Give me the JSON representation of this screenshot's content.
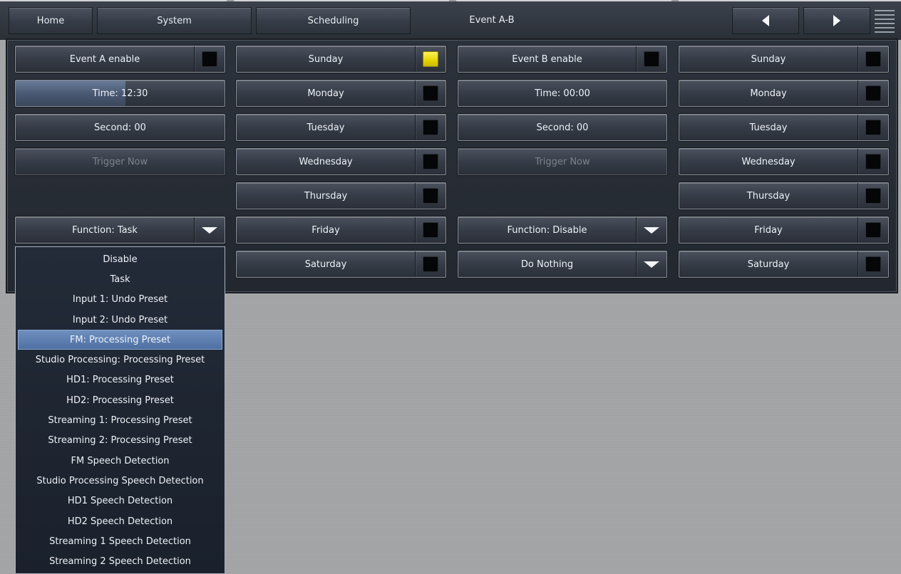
{
  "nav": {
    "home": "Home",
    "system": "System",
    "scheduling": "Scheduling",
    "title": "Event A-B",
    "prev_icon": "triangle-left",
    "next_icon": "triangle-right",
    "menu_icon": "hamburger-lines"
  },
  "event_a": {
    "enable_label": "Event A enable",
    "enabled": false,
    "time_label": "Time: 12:30",
    "time_fill_fraction": 0.52,
    "second_label": "Second: 00",
    "trigger_label": "Trigger Now",
    "function_label": "Function: Task",
    "days": [
      {
        "label": "Sunday",
        "checked": true
      },
      {
        "label": "Monday",
        "checked": false
      },
      {
        "label": "Tuesday",
        "checked": false
      },
      {
        "label": "Wednesday",
        "checked": false
      },
      {
        "label": "Thursday",
        "checked": false
      },
      {
        "label": "Friday",
        "checked": false
      },
      {
        "label": "Saturday",
        "checked": false
      }
    ]
  },
  "event_b": {
    "enable_label": "Event B enable",
    "enabled": false,
    "time_label": "Time: 00:00",
    "second_label": "Second: 00",
    "trigger_label": "Trigger Now",
    "function_label": "Function: Disable",
    "action_label": "Do Nothing",
    "days": [
      {
        "label": "Sunday",
        "checked": false
      },
      {
        "label": "Monday",
        "checked": false
      },
      {
        "label": "Tuesday",
        "checked": false
      },
      {
        "label": "Wednesday",
        "checked": false
      },
      {
        "label": "Thursday",
        "checked": false
      },
      {
        "label": "Friday",
        "checked": false
      },
      {
        "label": "Saturday",
        "checked": false
      }
    ]
  },
  "function_dropdown": {
    "selected_index": 4,
    "options": [
      "Disable",
      "Task",
      "Input 1: Undo Preset",
      "Input 2: Undo Preset",
      "FM: Processing Preset",
      "Studio Processing: Processing Preset",
      "HD1: Processing Preset",
      "HD2: Processing Preset",
      "Streaming 1: Processing Preset",
      "Streaming 2: Processing Preset",
      "FM Speech Detection",
      "Studio Processing Speech Detection",
      "HD1 Speech Detection",
      "HD2 Speech Detection",
      "Streaming 1 Speech Detection",
      "Streaming 2 Speech Detection"
    ]
  },
  "colors": {
    "check_on": "#f0e020",
    "selection": "#5f7fb1"
  }
}
